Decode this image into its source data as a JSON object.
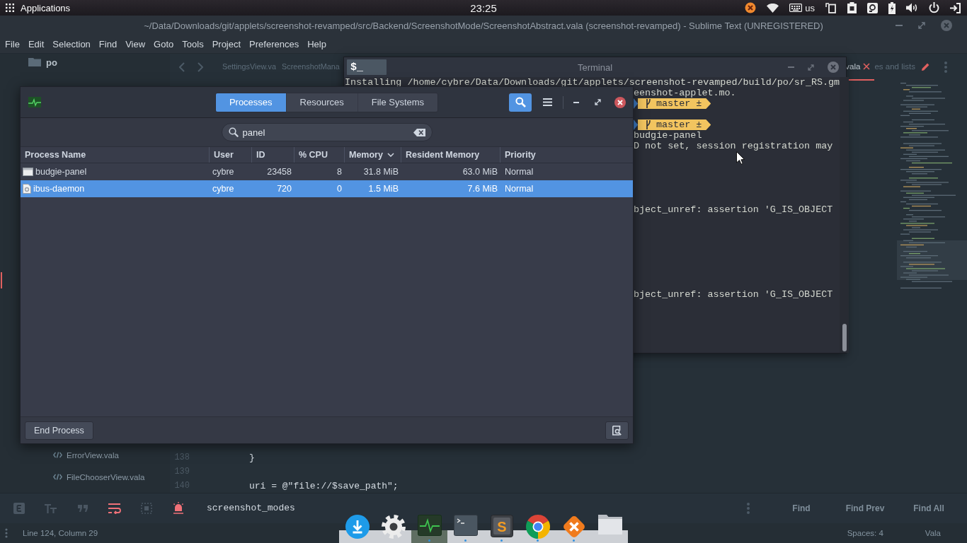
{
  "top_panel": {
    "menu_label": "Applications",
    "clock": "23:25",
    "keyboard_layout": "us"
  },
  "editor_window": {
    "title": "~/Data/Downloads/git/applets/screenshot-revamped/src/Backend/ScreenshotMode/ScreenshotAbstract.vala (screenshot-revamped) - Sublime Text (UNREGISTERED)",
    "menu": [
      "File",
      "Edit",
      "Selection",
      "Find",
      "View",
      "Goto",
      "Tools",
      "Project",
      "Preferences",
      "Help"
    ],
    "sidebar_top": [
      {
        "label": "po"
      }
    ],
    "sidebar_bottom": [
      {
        "label": "ErrorView.vala"
      },
      {
        "label": "FileChooserView.vala"
      }
    ],
    "tabs": [
      {
        "label": "SettingsView.va",
        "selected": false
      },
      {
        "label": "ScreenshotMana",
        "selected": false
      }
    ],
    "tabs_right": [
      {
        "label": "vala",
        "selected": true,
        "modified": false
      },
      {
        "label": "es and lists",
        "selected": false,
        "modified": true
      }
    ],
    "code_lines": [
      {
        "number": "138",
        "text": "}"
      },
      {
        "number": "139"
      },
      {
        "number": "140",
        "text": "uri = @\"file://$save_path\";"
      }
    ],
    "find_panel": {
      "options": [
        {
          "kind": "regex",
          "on": false
        },
        {
          "kind": "case",
          "on": false
        },
        {
          "kind": "word",
          "on": false
        },
        {
          "kind": "wrap",
          "on": true
        },
        {
          "kind": "selection",
          "on": false
        },
        {
          "kind": "highlight",
          "on": true
        }
      ],
      "query": "screenshot_modes",
      "buttons": [
        "Find",
        "Find Prev",
        "Find All"
      ]
    },
    "status_bar": {
      "position": "Line 124, Column 29",
      "indentation": "Spaces: 4",
      "syntax": "Vala"
    }
  },
  "terminal": {
    "title": "Terminal",
    "badge": "$_",
    "first_line": "Installing /home/cybre/Data/Downloads/git/applets/screenshot-revamped/build/po/sr_RS.gm",
    "lines": [
      {
        "kind": "text",
        "text": "eenshot-applet.mo."
      },
      {
        "kind": "prompt",
        "text": "master ±"
      },
      {
        "kind": "blank"
      },
      {
        "kind": "prompt",
        "text": "master ±"
      },
      {
        "kind": "text",
        "text": "budgie-panel"
      },
      {
        "kind": "text",
        "text": "D not set, session registration may"
      },
      {
        "kind": "blank"
      },
      {
        "kind": "blank"
      },
      {
        "kind": "blank"
      },
      {
        "kind": "blank"
      },
      {
        "kind": "blank"
      },
      {
        "kind": "text",
        "text": "bject_unref: assertion 'G_IS_OBJECT"
      },
      {
        "kind": "blank"
      },
      {
        "kind": "blank"
      },
      {
        "kind": "blank"
      },
      {
        "kind": "blank"
      },
      {
        "kind": "blank"
      },
      {
        "kind": "blank"
      },
      {
        "kind": "blank"
      },
      {
        "kind": "text",
        "text": "bject_unref: assertion 'G_IS_OBJECT"
      }
    ]
  },
  "system_monitor": {
    "tabs": [
      {
        "label": "Processes",
        "selected": true
      },
      {
        "label": "Resources",
        "selected": false
      },
      {
        "label": "File Systems",
        "selected": false
      }
    ],
    "search_toggle": {
      "on": true
    },
    "search": {
      "value": "panel"
    },
    "columns": [
      {
        "label": "Process Name",
        "sorted": false
      },
      {
        "label": "User",
        "sorted": false
      },
      {
        "label": "ID",
        "sorted": false
      },
      {
        "label": "% CPU",
        "sorted": false
      },
      {
        "label": "Memory",
        "sorted": true
      },
      {
        "label": "Resident Memory",
        "sorted": false
      },
      {
        "label": "Priority",
        "sorted": false
      }
    ],
    "rows": [
      {
        "kind": "app",
        "name": "budgie-panel",
        "user": "cybre",
        "id": "23458",
        "cpu": "8",
        "memory": "31.8 MiB",
        "resident_memory": "63.0 MiB",
        "priority": "Normal",
        "selected": false
      },
      {
        "kind": "daemon",
        "name": "ibus-daemon",
        "user": "cybre",
        "id": "720",
        "cpu": "0",
        "memory": "1.5 MiB",
        "resident_memory": "7.6 MiB",
        "priority": "Normal",
        "selected": true
      }
    ],
    "end_button": "End Process"
  },
  "dock": {
    "items": [
      {
        "kind": "download",
        "running": false,
        "selected": false
      },
      {
        "kind": "settings",
        "running": false,
        "selected": false
      },
      {
        "kind": "monitor",
        "running": true,
        "selected": true
      },
      {
        "kind": "terminal",
        "running": true,
        "selected": false
      },
      {
        "kind": "editor",
        "label": "S",
        "running": true,
        "selected": false
      },
      {
        "kind": "browser",
        "running": true,
        "selected": false
      },
      {
        "kind": "cross",
        "running": true,
        "selected": false
      },
      {
        "kind": "folder",
        "running": false,
        "selected": false
      }
    ]
  }
}
